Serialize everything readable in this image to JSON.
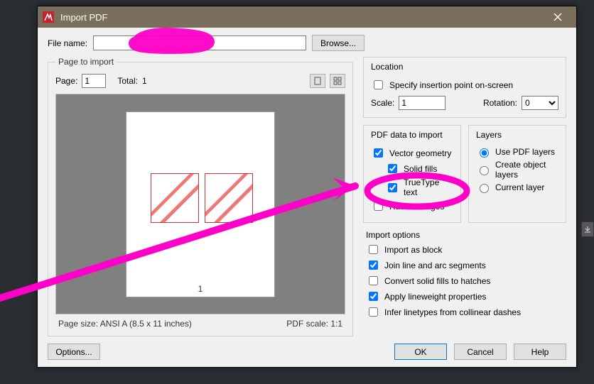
{
  "window": {
    "title": "Import PDF"
  },
  "file": {
    "label": "File name:",
    "value": "",
    "browse": "Browse..."
  },
  "page_group": {
    "legend": "Page to import",
    "page_label": "Page:",
    "page_value": "1",
    "total_label": "Total:",
    "total_value": "1",
    "page_number": "1",
    "size_label": "Page size:  ANSI A  (8.5 x 11 inches)",
    "scale_label": "PDF scale:  1:1"
  },
  "location": {
    "legend": "Location",
    "specify_label": "Specify insertion point on-screen",
    "specify_checked": false,
    "scale_label": "Scale:",
    "scale_value": "1",
    "rotation_label": "Rotation:",
    "rotation_value": "0"
  },
  "pdfdata": {
    "legend": "PDF data to import",
    "vector": {
      "label": "Vector geometry",
      "checked": true
    },
    "solid": {
      "label": "Solid fills",
      "checked": true
    },
    "truetype": {
      "label": "TrueType text",
      "checked": true
    },
    "raster": {
      "label": "Raster images",
      "checked": false
    }
  },
  "layers": {
    "legend": "Layers",
    "use_pdf": "Use PDF layers",
    "create": "Create object layers",
    "current": "Current layer",
    "selected": "use_pdf"
  },
  "import": {
    "legend": "Import options",
    "block": {
      "label": "Import as block",
      "checked": false
    },
    "join": {
      "label": "Join line and arc segments",
      "checked": true
    },
    "convert": {
      "label": "Convert solid fills to hatches",
      "checked": false
    },
    "linewt": {
      "label": "Apply lineweight properties",
      "checked": true
    },
    "infer": {
      "label": "Infer linetypes from collinear dashes",
      "checked": false
    }
  },
  "buttons": {
    "options": "Options...",
    "ok": "OK",
    "cancel": "Cancel",
    "help": "Help"
  }
}
